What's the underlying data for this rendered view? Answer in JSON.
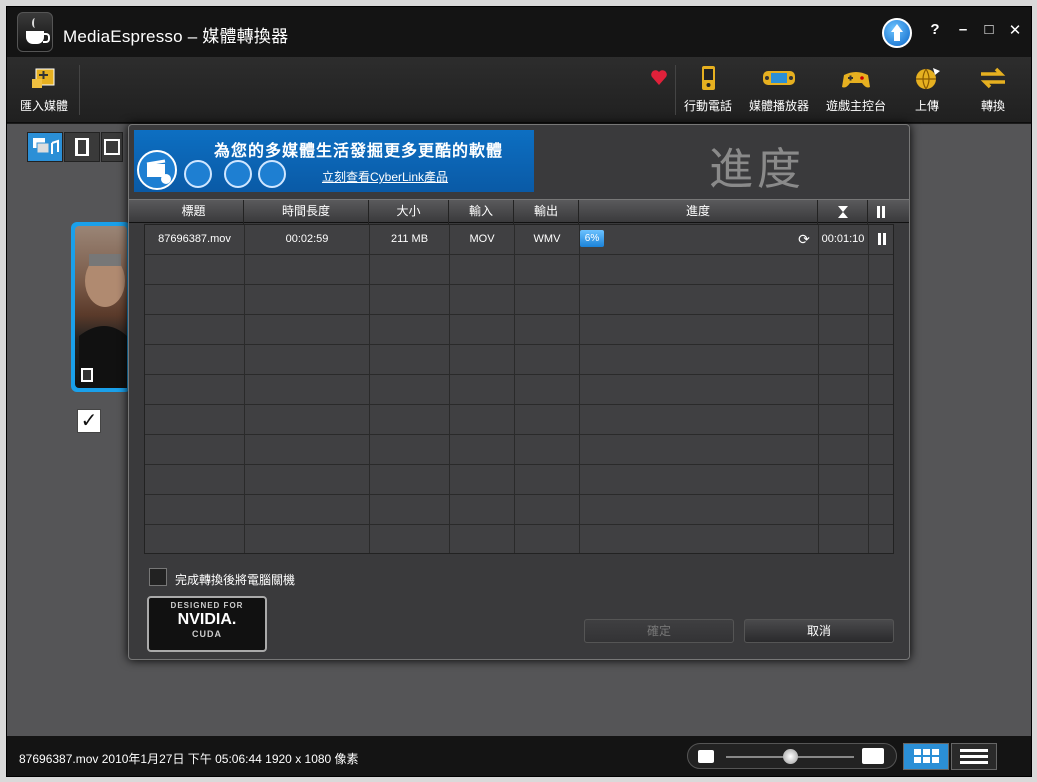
{
  "window": {
    "title": "MediaEspresso – 媒體轉換器"
  },
  "titlebar": {
    "help_label": "?",
    "minimize_label": "–",
    "maximize_label": "□",
    "close_label": "✕"
  },
  "toolbar": {
    "import_label": "匯入媒體",
    "targets": [
      {
        "label": "行動電話",
        "icon": "mobile-phone-icon"
      },
      {
        "label": "媒體播放器",
        "icon": "media-player-icon"
      },
      {
        "label": "遊戲主控台",
        "icon": "game-console-icon"
      },
      {
        "label": "上傳",
        "icon": "upload-globe-icon"
      },
      {
        "label": "轉換",
        "icon": "convert-arrows-icon"
      }
    ],
    "favorite_icon": "heart-icon"
  },
  "banner": {
    "headline": "為您的多媒體生活發掘更多更酷的軟體",
    "link": "立刻查看CyberLink產品"
  },
  "dialog": {
    "title": "進度",
    "columns": [
      "標題",
      "時間長度",
      "大小",
      "輸入",
      "輸出",
      "進度"
    ],
    "rows": [
      {
        "title": "87696387.mov",
        "duration": "00:02:59",
        "size": "211 MB",
        "input": "MOV",
        "output": "WMV",
        "progress": "6%",
        "remaining": "00:01:10"
      }
    ],
    "shutdown_option": "完成轉換後將電腦關機",
    "ok_label": "確定",
    "cancel_label": "取消",
    "nvidia": {
      "line1": "DESIGNED FOR",
      "line2": "NVIDIA.",
      "line3": "CUDA"
    }
  },
  "statusbar": {
    "info": "87696387.mov 2010年1月27日 下午 05:06:44 1920 x 1080 像素"
  },
  "colors": {
    "accent": "#2b8fd6",
    "background": "#555557",
    "dialog": "#3a3a3c"
  }
}
